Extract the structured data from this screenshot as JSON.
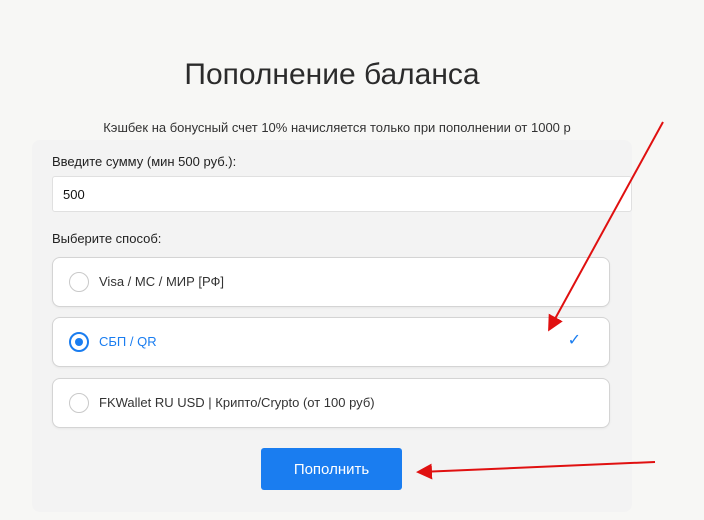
{
  "page": {
    "title": "Пополнение баланса",
    "cashback_note": "Кэшбек на бонусный счет 10% начисляется только при пополнении от 1000 р"
  },
  "form": {
    "amount_label": "Введите сумму (мин 500 руб.):",
    "amount_value": "500",
    "method_label": "Выберите способ:",
    "methods": [
      {
        "label": "Visa / MC / МИР [РФ]",
        "selected": false
      },
      {
        "label": "СБП / QR",
        "selected": true,
        "check": "✓"
      },
      {
        "label": "FKWallet RU USD | Крипто/Crypto (от 100 руб)",
        "selected": false
      }
    ],
    "submit_label": "Пополнить"
  },
  "colors": {
    "accent": "#1a7df0",
    "annotation_arrow": "#e01010"
  }
}
